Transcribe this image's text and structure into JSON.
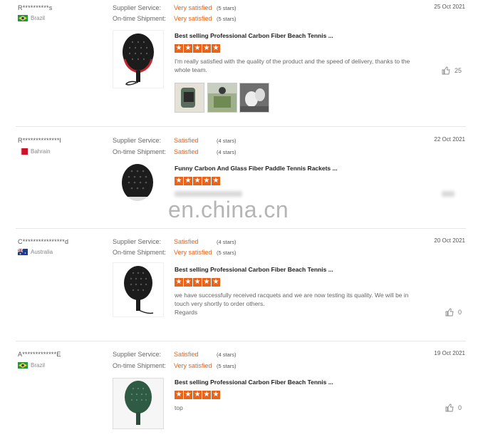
{
  "labels": {
    "supplier_service": "Supplier Service:",
    "ontime_shipment": "On-time Shipment:"
  },
  "reviews": [
    {
      "buyer": "R**********s",
      "country": "Brazil",
      "supplier_value": "Very satisfied",
      "supplier_stars": "(5 stars)",
      "shipment_value": "Very satisfied",
      "shipment_stars": "(5 stars)",
      "date": "25 Oct 2021",
      "product_title": "Best selling Professional Carbon Fiber Beach Tennis ...",
      "rating": 5,
      "text": "I'm really satisfied with the quality of the product and the speed of delivery, thanks to the whole team.",
      "likes": "25"
    },
    {
      "buyer": "R**************l",
      "country": "Bahrain",
      "supplier_value": "Satisfied",
      "supplier_stars": "(4 stars)",
      "shipment_value": "Satisfied",
      "shipment_stars": "(4 stars)",
      "date": "22 Oct 2021",
      "product_title": "Funny Carbon And Glass Fiber Paddle Tennis Rackets ...",
      "rating": 5,
      "text": "",
      "likes": ""
    },
    {
      "buyer": "C****************d",
      "country": "Australia",
      "supplier_value": "Satisfied",
      "supplier_stars": "(4 stars)",
      "shipment_value": "Very satisfied",
      "shipment_stars": "(5 stars)",
      "date": "20 Oct 2021",
      "product_title": "Best selling Professional Carbon Fiber Beach Tennis ...",
      "rating": 5,
      "text": "we have successfully received racquets and we are now testing its quality. We will be in touch very shortly to order others.",
      "text2": "Regards",
      "likes": "0"
    },
    {
      "buyer": "A*************E",
      "country": "Brazil",
      "supplier_value": "Satisfied",
      "supplier_stars": "(4 stars)",
      "shipment_value": "Very satisfied",
      "shipment_stars": "(5 stars)",
      "date": "19 Oct 2021",
      "product_title": "Best selling Professional Carbon Fiber Beach Tennis ...",
      "rating": 5,
      "text": "top",
      "likes": "0"
    }
  ],
  "watermark": "en.china.cn",
  "colors": {
    "accent": "#e8641b",
    "racket_dark": "#1c1c1c",
    "racket_red": "#c0272d",
    "racket_green": "#2f5a43"
  },
  "icons": {
    "star": "star-icon",
    "like": "thumbs-up-icon"
  }
}
